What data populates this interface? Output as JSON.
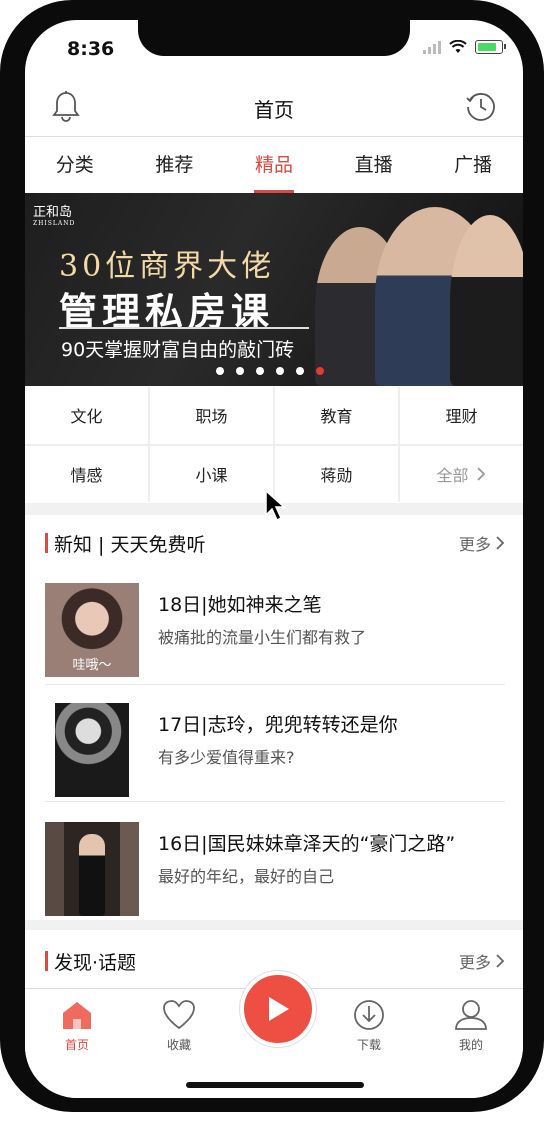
{
  "status_bar": {
    "time": "8:36"
  },
  "header": {
    "title": "首页",
    "left_icon": "bell-icon",
    "right_icon": "history-clock-icon"
  },
  "tabs": [
    {
      "label": "分类"
    },
    {
      "label": "推荐"
    },
    {
      "label": "精品",
      "active": true
    },
    {
      "label": "直播"
    },
    {
      "label": "广播"
    }
  ],
  "banner": {
    "brand": "正和岛",
    "brand_en": "ZHISLAND",
    "line1": "30位商界大佬",
    "line2": "管理私房课",
    "line3": "90天掌握财富自由的敲门砖",
    "slide_count": 6,
    "active_slide": 6
  },
  "categories": [
    {
      "label": "文化"
    },
    {
      "label": "职场"
    },
    {
      "label": "教育"
    },
    {
      "label": "理财"
    },
    {
      "label": "情感"
    },
    {
      "label": "小课"
    },
    {
      "label": "蒋勋"
    },
    {
      "label": "全部"
    }
  ],
  "section1": {
    "title": "新知 | 天天免费听",
    "more": "更多",
    "items": [
      {
        "title": "18日|她如神来之笔",
        "subtitle": "被痛批的流量小生们都有救了",
        "thumb_caption": "哇哦～"
      },
      {
        "title": "17日|志玲，兜兜转转还是你",
        "subtitle": "有多少爱值得重来?",
        "thumb_caption": ""
      },
      {
        "title": "16日|国民妹妹章泽天的“豪门之路”",
        "subtitle": "最好的年纪，最好的自己",
        "thumb_caption": ""
      }
    ]
  },
  "section2": {
    "title": "发现·话题",
    "more": "更多"
  },
  "tabbar": {
    "items": [
      {
        "label": "首页",
        "icon": "home-icon",
        "active": true
      },
      {
        "label": "收藏",
        "icon": "heart-icon"
      },
      {
        "label": "",
        "icon": "play-icon"
      },
      {
        "label": "下载",
        "icon": "download-icon"
      },
      {
        "label": "我的",
        "icon": "user-icon"
      }
    ]
  },
  "colors": {
    "accent": "#d94a3f",
    "play_button": "#ee4f43"
  }
}
